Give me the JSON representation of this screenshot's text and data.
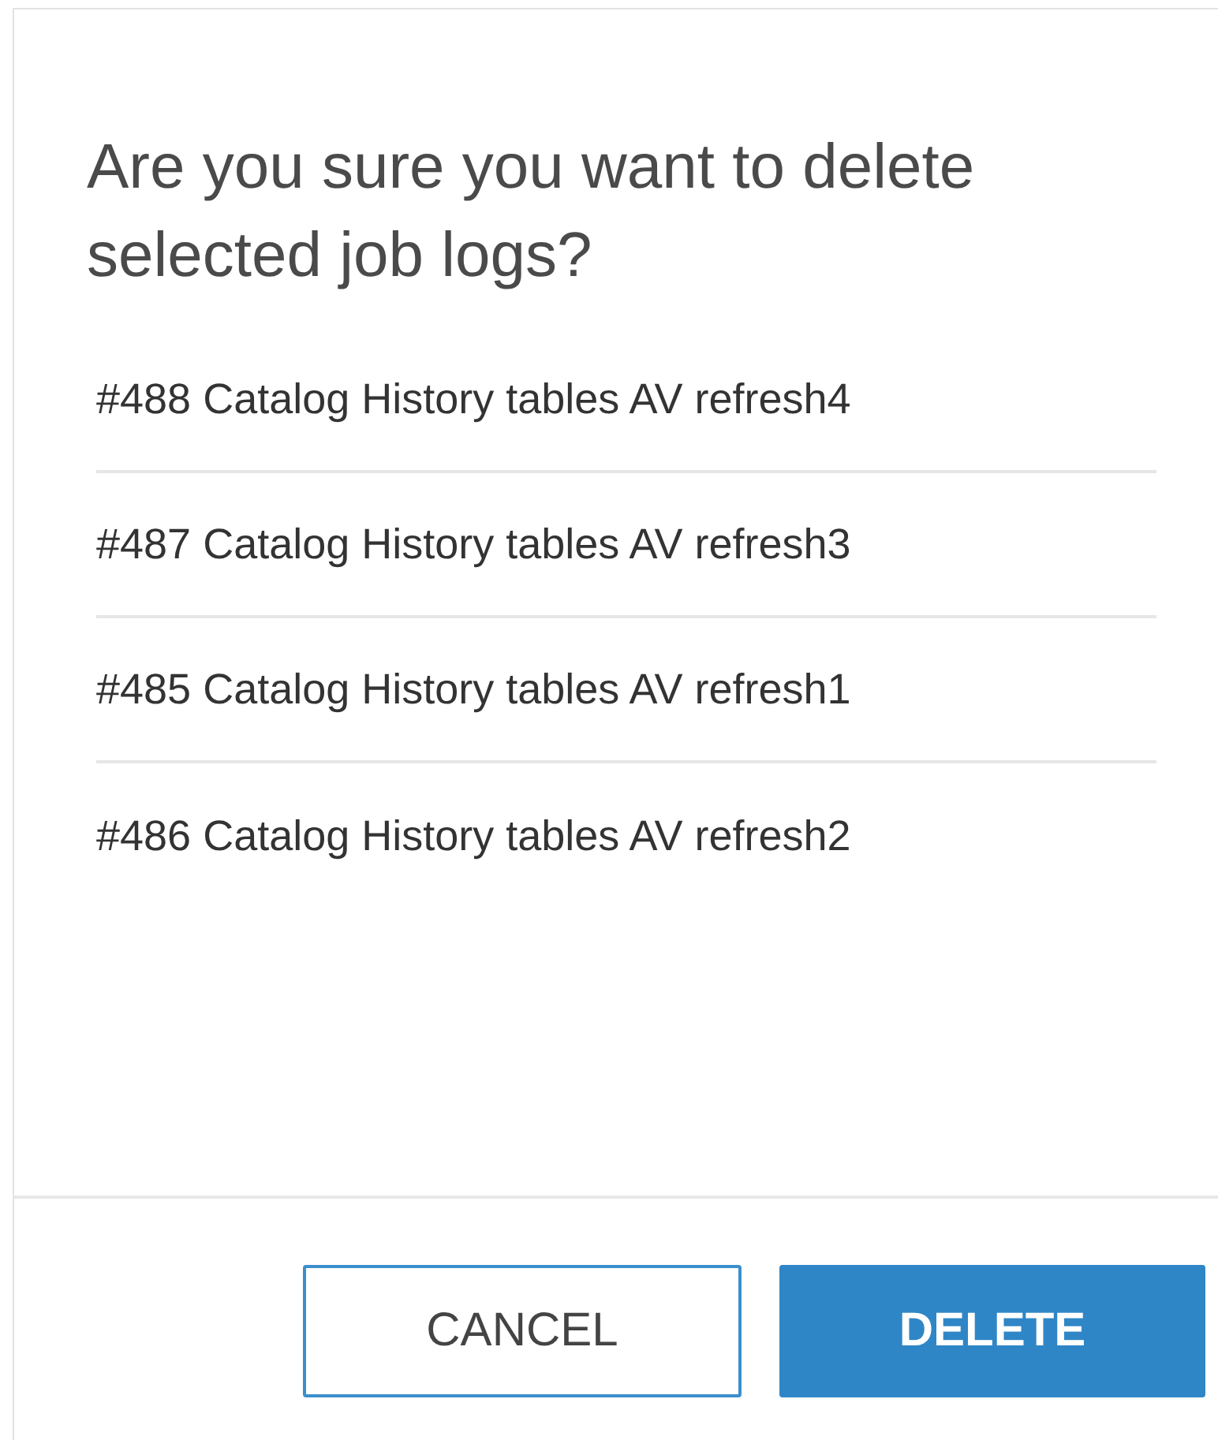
{
  "dialog": {
    "question": "Are you sure you want to delete selected job logs?",
    "items": [
      "#488 Catalog History tables AV refresh4",
      "#487 Catalog History tables AV refresh3",
      "#485 Catalog History tables AV refresh1",
      "#486 Catalog History tables AV refresh2"
    ],
    "buttons": [
      {
        "label": "CANCEL",
        "kind": "secondary"
      },
      {
        "label": "DELETE",
        "kind": "primary"
      }
    ]
  }
}
